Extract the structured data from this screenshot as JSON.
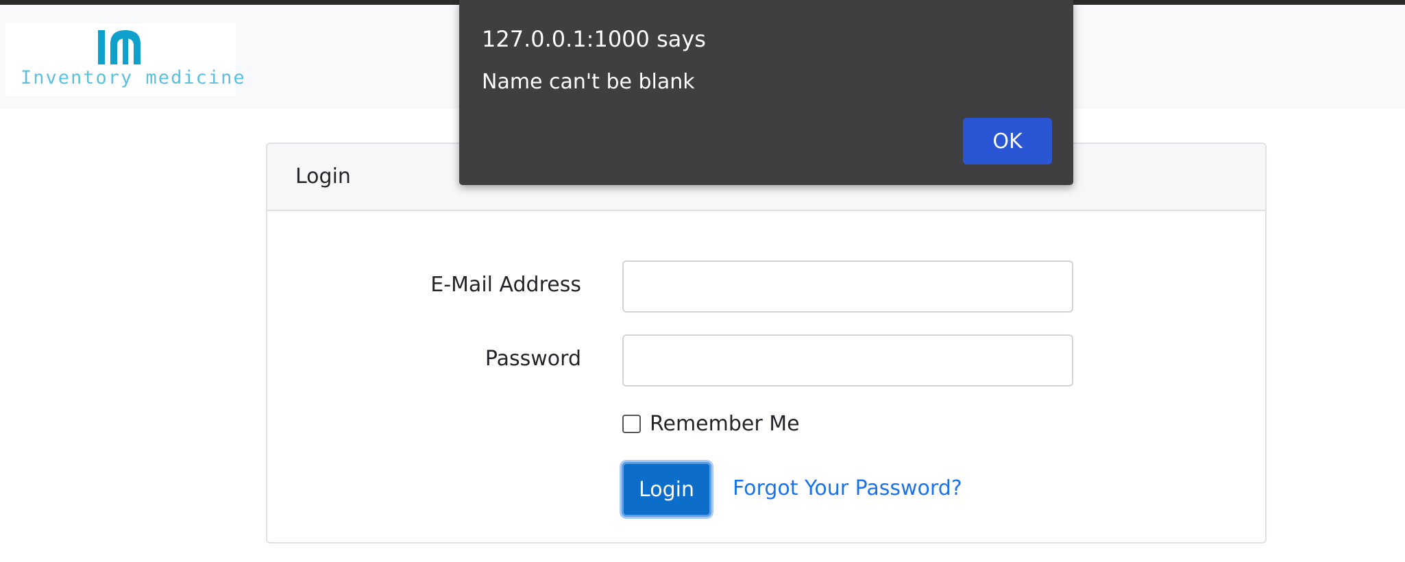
{
  "app": {
    "logo_text": "Inventory medicine",
    "logo_icon": "im-monogram-icon",
    "brand_color": "#0fa0cc"
  },
  "login_card": {
    "title": "Login",
    "email_label": "E-Mail Address",
    "email_value": "",
    "password_label": "Password",
    "password_value": "",
    "remember_label": "Remember Me",
    "remember_checked": false,
    "login_button": "Login",
    "forgot_link": "Forgot Your Password?"
  },
  "alert_dialog": {
    "title": "127.0.0.1:1000 says",
    "message": "Name can't be blank",
    "ok_button": "OK"
  }
}
